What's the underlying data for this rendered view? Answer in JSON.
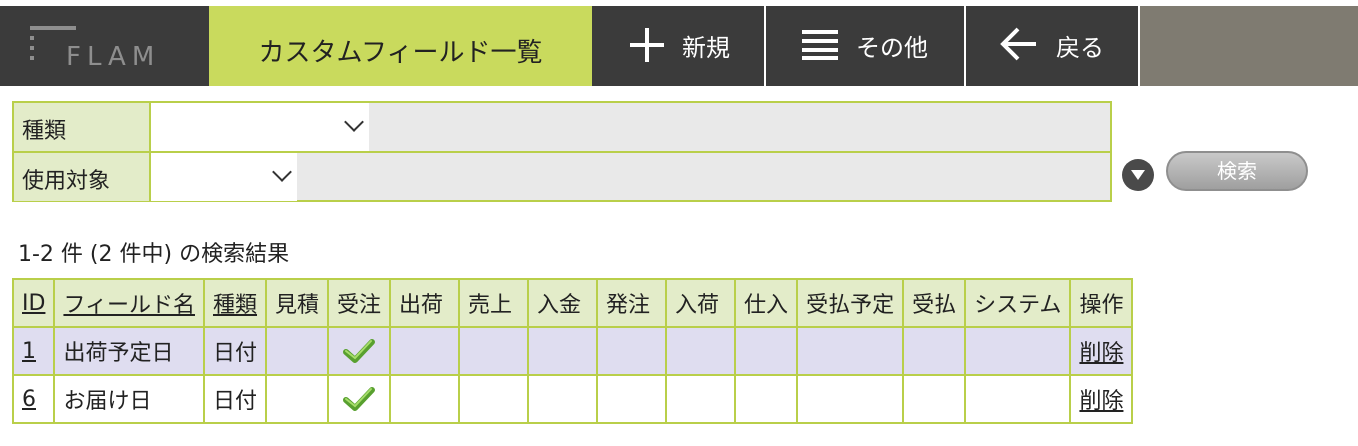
{
  "nav": {
    "logo": "FLAM",
    "current_tab": "カスタムフィールド一覧",
    "new_label": "新規",
    "other_label": "その他",
    "back_label": "戻る"
  },
  "search": {
    "fields": [
      {
        "label": "種類",
        "value": ""
      },
      {
        "label": "使用対象",
        "value": ""
      }
    ],
    "button_label": "検索"
  },
  "result_info": "1-2 件 (2 件中) の検索結果",
  "table": {
    "columns": [
      "ID",
      "フィールド名",
      "種類",
      "見積",
      "受注",
      "出荷",
      "売上",
      "入金",
      "発注",
      "入荷",
      "仕入",
      "受払予定",
      "受払",
      "システム",
      "操作"
    ],
    "rows": [
      {
        "id": "1",
        "name": "出荷予定日",
        "type": "日付",
        "checks": {
          "受注": true
        },
        "action": "削除"
      },
      {
        "id": "6",
        "name": "お届け日",
        "type": "日付",
        "checks": {
          "受注": true
        },
        "action": "削除"
      }
    ]
  },
  "colors": {
    "accent": "#c9da5d",
    "border": "#b9cf4a",
    "nav_dark": "#3b3b3b",
    "row_shade": "#dfddf0"
  }
}
